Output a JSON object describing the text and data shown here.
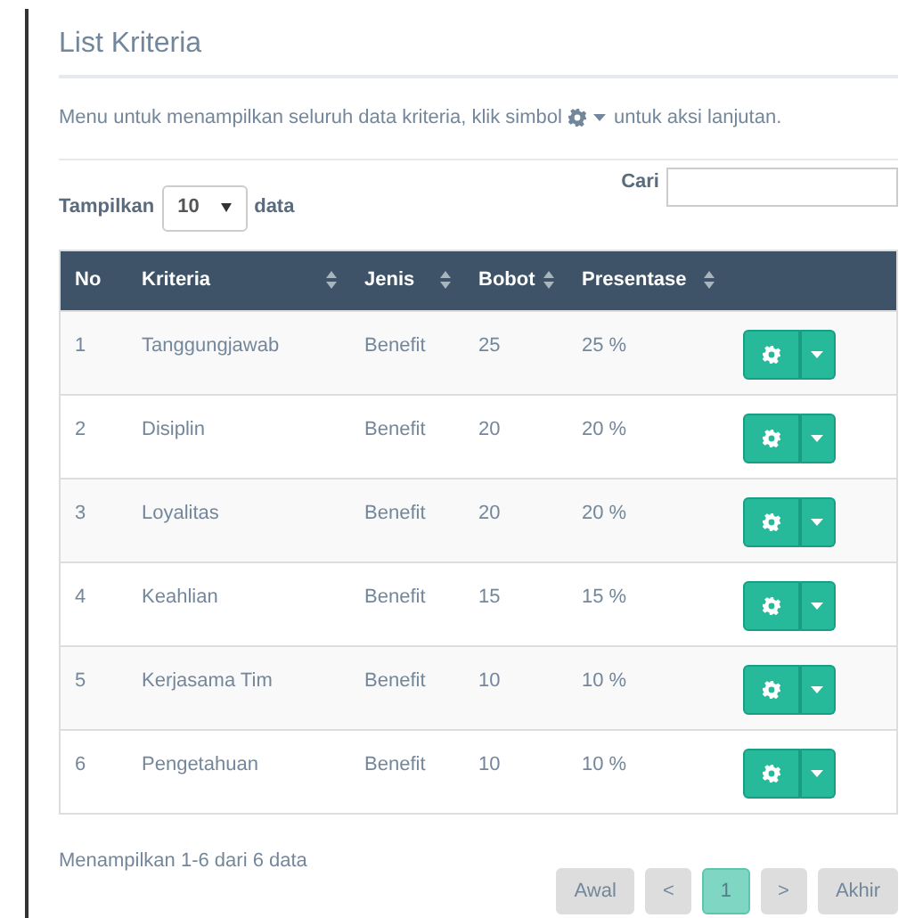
{
  "title": "List Kriteria",
  "description": {
    "before": "Menu untuk menampilkan seluruh data kriteria, klik simbol",
    "after": "untuk aksi lanjutan."
  },
  "length_control": {
    "label_before": "Tampilkan",
    "value": "10",
    "label_after": "data"
  },
  "search": {
    "label": "Cari"
  },
  "table": {
    "columns": [
      {
        "label": "No",
        "sortable": false
      },
      {
        "label": "Kriteria",
        "sortable": true
      },
      {
        "label": "Jenis",
        "sortable": true
      },
      {
        "label": "Bobot",
        "sortable": true
      },
      {
        "label": "Presentase",
        "sortable": true
      }
    ],
    "rows": [
      {
        "cells": [
          "1",
          "Tanggungjawab",
          "Benefit",
          "25",
          "25 %"
        ]
      },
      {
        "cells": [
          "2",
          "Disiplin",
          "Benefit",
          "20",
          "20 %"
        ]
      },
      {
        "cells": [
          "3",
          "Loyalitas",
          "Benefit",
          "20",
          "20 %"
        ]
      },
      {
        "cells": [
          "4",
          "Keahlian",
          "Benefit",
          "15",
          "15 %"
        ]
      },
      {
        "cells": [
          "5",
          "Kerjasama Tim",
          "Benefit",
          "10",
          "10 %"
        ]
      },
      {
        "cells": [
          "6",
          "Pengetahuan",
          "Benefit",
          "10",
          "10 %"
        ]
      }
    ]
  },
  "info": "Menampilkan 1-6 dari 6 data",
  "pagination": [
    {
      "label": "Awal",
      "selected": false
    },
    {
      "label": "<",
      "selected": false
    },
    {
      "label": "1",
      "selected": true
    },
    {
      "label": ">",
      "selected": false
    },
    {
      "label": "Akhir",
      "selected": false
    }
  ]
}
